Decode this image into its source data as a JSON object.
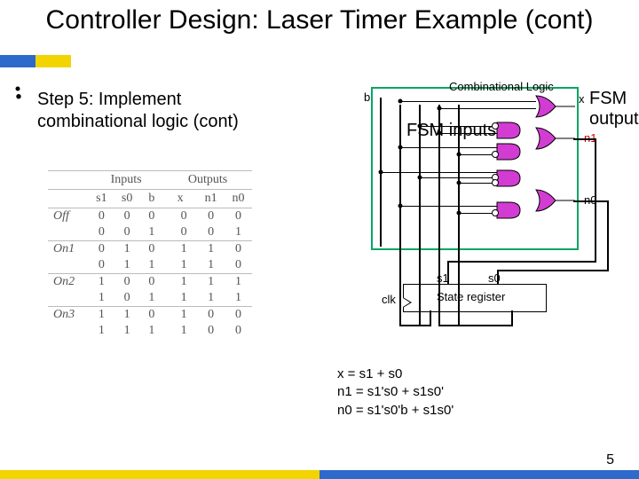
{
  "title": "Controller Design: Laser Timer Example (cont)",
  "bullet": {
    "text": "Step 5: Implement combinational logic (cont)"
  },
  "diagram": {
    "comb_label": "Combinational Logic",
    "fsm_inputs": "FSM inputs",
    "fsm_outputs": "FSM outputs",
    "input_b": "b",
    "out_x": "x",
    "out_n1": "n1",
    "out_n0": "n0",
    "state_s1": "s1",
    "state_s0": "s0",
    "clk": "clk",
    "state_register": "State register"
  },
  "table": {
    "group_inputs": "Inputs",
    "group_outputs": "Outputs",
    "cols": [
      "s1",
      "s0",
      "b",
      "x",
      "n1",
      "n0"
    ],
    "sections": [
      {
        "state": "Off",
        "rows": [
          [
            0,
            0,
            0,
            0,
            0,
            0
          ],
          [
            0,
            0,
            1,
            0,
            0,
            1
          ]
        ]
      },
      {
        "state": "On1",
        "rows": [
          [
            0,
            1,
            0,
            1,
            1,
            0
          ],
          [
            0,
            1,
            1,
            1,
            1,
            0
          ]
        ]
      },
      {
        "state": "On2",
        "rows": [
          [
            1,
            0,
            0,
            1,
            1,
            1
          ],
          [
            1,
            0,
            1,
            1,
            1,
            1
          ]
        ]
      },
      {
        "state": "On3",
        "rows": [
          [
            1,
            1,
            0,
            1,
            0,
            0
          ],
          [
            1,
            1,
            1,
            1,
            0,
            0
          ]
        ]
      }
    ]
  },
  "equations": {
    "x": "x = s1 + s0",
    "n1": "n1 = s1's0 + s1s0'",
    "n0": "n0 = s1's0'b + s1s0'"
  },
  "page_number": "5"
}
